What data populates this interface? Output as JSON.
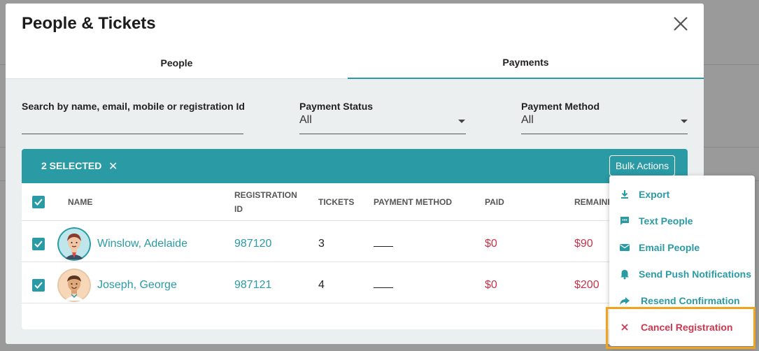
{
  "modal": {
    "title": "People & Tickets",
    "tabs": [
      {
        "label": "People",
        "active": false
      },
      {
        "label": "Payments",
        "active": true
      }
    ]
  },
  "filters": {
    "search_label": "Search by name, email, mobile or registration Id",
    "search_value": "",
    "payment_status_label": "Payment Status",
    "payment_status_value": "All",
    "payment_method_label": "Payment Method",
    "payment_method_value": "All"
  },
  "selection": {
    "count_label": "2 SELECTED",
    "clear_glyph": "✕",
    "bulk_actions_label": "Bulk Actions"
  },
  "table": {
    "headers": {
      "name": "NAME",
      "registration_id_line1": "REGISTRATION",
      "registration_id_line2": "ID",
      "tickets": "TICKETS",
      "payment_method": "PAYMENT METHOD",
      "paid": "PAID",
      "remaining": "REMAINI"
    },
    "rows": [
      {
        "name": "Winslow, Adelaide",
        "registration_id": "987120",
        "tickets": "3",
        "payment_method": "",
        "paid": "$0",
        "remaining": "$90",
        "checked": true
      },
      {
        "name": "Joseph, George",
        "registration_id": "987121",
        "tickets": "4",
        "payment_method": "",
        "paid": "$0",
        "remaining": "$200",
        "checked": true
      }
    ]
  },
  "bulk_menu": {
    "items": [
      {
        "label": "Export",
        "icon": "download-icon"
      },
      {
        "label": "Text People",
        "icon": "chat-icon"
      },
      {
        "label": "Email People",
        "icon": "email-icon"
      },
      {
        "label": "Send Push Notifications",
        "icon": "bell-icon"
      },
      {
        "label": "Resend Confirmation",
        "icon": "forward-arrow-icon"
      },
      {
        "label": "Cancel Registration",
        "icon": "close-icon"
      }
    ]
  },
  "colors": {
    "accent": "#2a9aa5",
    "danger": "#d0364e",
    "highlight": "#f0a41e"
  }
}
